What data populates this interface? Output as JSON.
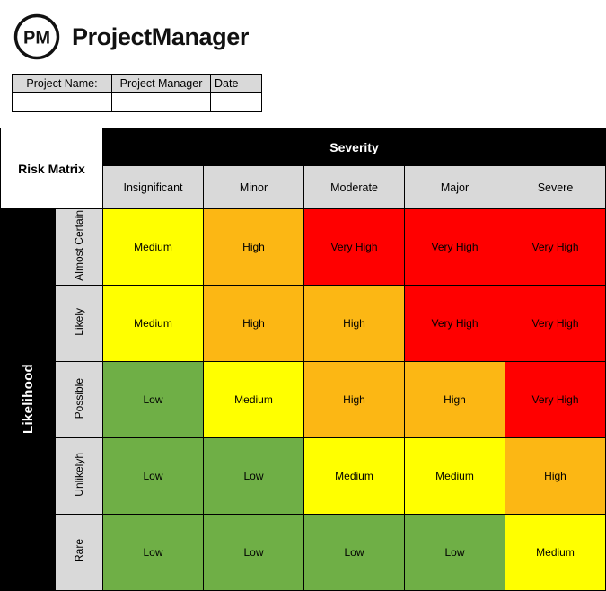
{
  "brand": {
    "logo_text": "PM",
    "logo_icon": "pm-circle-logo",
    "name": "ProjectManager"
  },
  "project_info": {
    "headers": [
      {
        "label": "Project Name:",
        "align": "center"
      },
      {
        "label": "Project Manager",
        "align": "center"
      },
      {
        "label": "Date",
        "align": "left"
      }
    ],
    "values": [
      "",
      "",
      ""
    ]
  },
  "matrix": {
    "corner_label": "Risk Matrix",
    "severity_axis_label": "Severity",
    "likelihood_axis_label": "Likelihood",
    "severity_levels": [
      "Insignificant",
      "Minor",
      "Moderate",
      "Major",
      "Severe"
    ],
    "likelihood_levels": [
      "Almost Certain",
      "Likely",
      "Possible",
      "Unlikelyh",
      "Rare"
    ],
    "colors": {
      "low": "#6faf46",
      "medium": "#ffff00",
      "high": "#fcb714",
      "very_high": "#ff0000",
      "header_gray": "#d9d9d9",
      "axis_black": "#000000"
    },
    "rows": [
      {
        "likelihood": "Almost Certain",
        "cells": [
          {
            "label": "Medium",
            "level": "medium"
          },
          {
            "label": "High",
            "level": "high"
          },
          {
            "label": "Very High",
            "level": "very-high"
          },
          {
            "label": "Very High",
            "level": "very-high"
          },
          {
            "label": "Very High",
            "level": "very-high"
          }
        ]
      },
      {
        "likelihood": "Likely",
        "cells": [
          {
            "label": "Medium",
            "level": "medium"
          },
          {
            "label": "High",
            "level": "high"
          },
          {
            "label": "High",
            "level": "high"
          },
          {
            "label": "Very High",
            "level": "very-high"
          },
          {
            "label": "Very High",
            "level": "very-high"
          }
        ]
      },
      {
        "likelihood": "Possible",
        "cells": [
          {
            "label": "Low",
            "level": "low"
          },
          {
            "label": "Medium",
            "level": "medium"
          },
          {
            "label": "High",
            "level": "high"
          },
          {
            "label": "High",
            "level": "high"
          },
          {
            "label": "Very High",
            "level": "very-high"
          }
        ]
      },
      {
        "likelihood": "Unlikelyh",
        "cells": [
          {
            "label": "Low",
            "level": "low"
          },
          {
            "label": "Low",
            "level": "low"
          },
          {
            "label": "Medium",
            "level": "medium"
          },
          {
            "label": "Medium",
            "level": "medium"
          },
          {
            "label": "High",
            "level": "high"
          }
        ]
      },
      {
        "likelihood": "Rare",
        "cells": [
          {
            "label": "Low",
            "level": "low"
          },
          {
            "label": "Low",
            "level": "low"
          },
          {
            "label": "Low",
            "level": "low"
          },
          {
            "label": "Low",
            "level": "low"
          },
          {
            "label": "Medium",
            "level": "medium"
          }
        ]
      }
    ]
  }
}
